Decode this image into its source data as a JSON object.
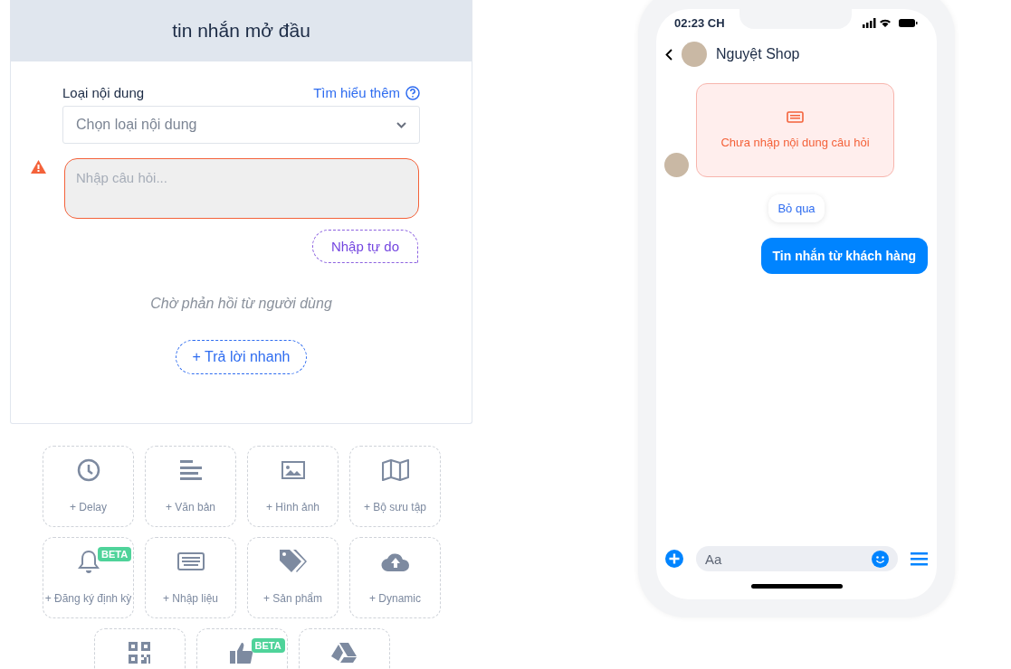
{
  "editor": {
    "title": "tin nhắn mở đầu",
    "content_type": {
      "label": "Loại nội dung",
      "help_link": "Tìm hiểu thêm",
      "placeholder": "Chọn loại nội dung"
    },
    "question": {
      "placeholder": "Nhập câu hỏi...",
      "error": true
    },
    "free_input_button": "Nhập tự do",
    "waiting_text": "Chờ phản hồi từ người dùng",
    "quick_reply_button": "+ Trả lời nhanh"
  },
  "blocks": [
    {
      "kind": "clock",
      "label": "+ Delay"
    },
    {
      "kind": "text",
      "label": "+ Văn bản"
    },
    {
      "kind": "image",
      "label": "+ Hình ảnh"
    },
    {
      "kind": "map",
      "label": "+ Bộ sưu tập"
    },
    {
      "kind": "bell",
      "label": "+ Đăng ký định kỳ",
      "badge": "BETA"
    },
    {
      "kind": "keyboard",
      "label": "+ Nhập liệu"
    },
    {
      "kind": "tags",
      "label": "+ Sản phẩm"
    },
    {
      "kind": "cloud",
      "label": "+ Dynamic"
    },
    {
      "kind": "qr"
    },
    {
      "kind": "thumb",
      "badge": "BETA"
    },
    {
      "kind": "drive"
    }
  ],
  "phone": {
    "time": "02:23 CH",
    "contact": "Nguyệt Shop",
    "error_message": "Chưa nhập nội dung câu hỏi",
    "skip_button": "Bỏ qua",
    "customer_message": "Tin nhắn từ khách hàng",
    "composer_placeholder": "Aa"
  }
}
